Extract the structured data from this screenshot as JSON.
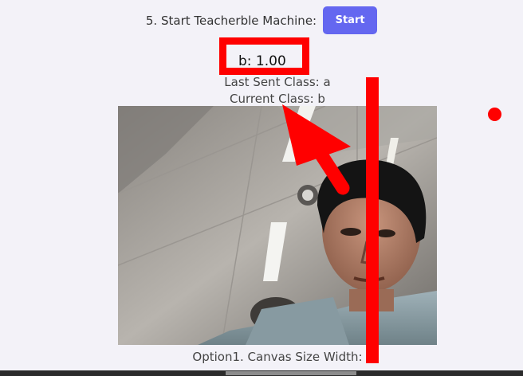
{
  "step": {
    "label": "5. Start Teacherble Machine:",
    "button_label": "Start"
  },
  "prediction": {
    "text": "b: 1.00"
  },
  "status": {
    "last_sent": "Last Sent Class: a",
    "current_class": "Current Class: b"
  },
  "option": {
    "label": "Option1. Canvas Size Width:"
  },
  "colors": {
    "background": "#f3f2f8",
    "button": "#6467f0",
    "annotation": "#ff0000"
  },
  "icons": {
    "arrow": "red-arrow-icon",
    "dot": "red-dot-icon"
  }
}
